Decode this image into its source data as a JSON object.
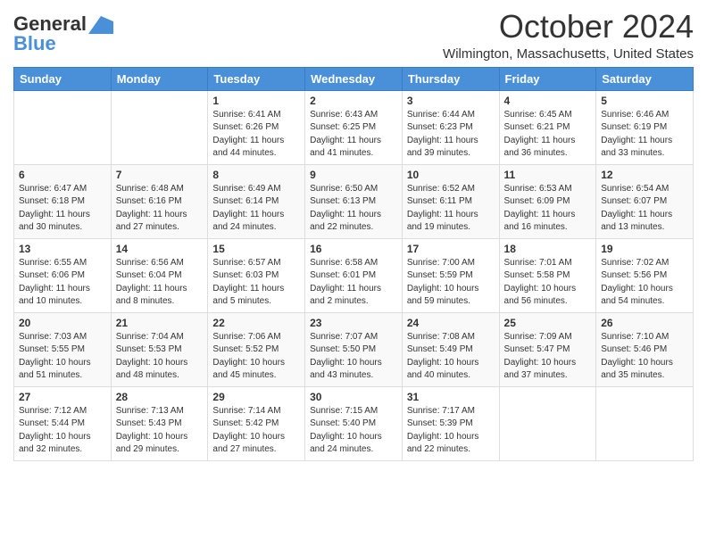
{
  "header": {
    "logo_general": "General",
    "logo_blue": "Blue",
    "month_title": "October 2024",
    "location": "Wilmington, Massachusetts, United States"
  },
  "weekdays": [
    "Sunday",
    "Monday",
    "Tuesday",
    "Wednesday",
    "Thursday",
    "Friday",
    "Saturday"
  ],
  "weeks": [
    [
      {
        "day": "",
        "info": ""
      },
      {
        "day": "",
        "info": ""
      },
      {
        "day": "1",
        "info": "Sunrise: 6:41 AM\nSunset: 6:26 PM\nDaylight: 11 hours and 44 minutes."
      },
      {
        "day": "2",
        "info": "Sunrise: 6:43 AM\nSunset: 6:25 PM\nDaylight: 11 hours and 41 minutes."
      },
      {
        "day": "3",
        "info": "Sunrise: 6:44 AM\nSunset: 6:23 PM\nDaylight: 11 hours and 39 minutes."
      },
      {
        "day": "4",
        "info": "Sunrise: 6:45 AM\nSunset: 6:21 PM\nDaylight: 11 hours and 36 minutes."
      },
      {
        "day": "5",
        "info": "Sunrise: 6:46 AM\nSunset: 6:19 PM\nDaylight: 11 hours and 33 minutes."
      }
    ],
    [
      {
        "day": "6",
        "info": "Sunrise: 6:47 AM\nSunset: 6:18 PM\nDaylight: 11 hours and 30 minutes."
      },
      {
        "day": "7",
        "info": "Sunrise: 6:48 AM\nSunset: 6:16 PM\nDaylight: 11 hours and 27 minutes."
      },
      {
        "day": "8",
        "info": "Sunrise: 6:49 AM\nSunset: 6:14 PM\nDaylight: 11 hours and 24 minutes."
      },
      {
        "day": "9",
        "info": "Sunrise: 6:50 AM\nSunset: 6:13 PM\nDaylight: 11 hours and 22 minutes."
      },
      {
        "day": "10",
        "info": "Sunrise: 6:52 AM\nSunset: 6:11 PM\nDaylight: 11 hours and 19 minutes."
      },
      {
        "day": "11",
        "info": "Sunrise: 6:53 AM\nSunset: 6:09 PM\nDaylight: 11 hours and 16 minutes."
      },
      {
        "day": "12",
        "info": "Sunrise: 6:54 AM\nSunset: 6:07 PM\nDaylight: 11 hours and 13 minutes."
      }
    ],
    [
      {
        "day": "13",
        "info": "Sunrise: 6:55 AM\nSunset: 6:06 PM\nDaylight: 11 hours and 10 minutes."
      },
      {
        "day": "14",
        "info": "Sunrise: 6:56 AM\nSunset: 6:04 PM\nDaylight: 11 hours and 8 minutes."
      },
      {
        "day": "15",
        "info": "Sunrise: 6:57 AM\nSunset: 6:03 PM\nDaylight: 11 hours and 5 minutes."
      },
      {
        "day": "16",
        "info": "Sunrise: 6:58 AM\nSunset: 6:01 PM\nDaylight: 11 hours and 2 minutes."
      },
      {
        "day": "17",
        "info": "Sunrise: 7:00 AM\nSunset: 5:59 PM\nDaylight: 10 hours and 59 minutes."
      },
      {
        "day": "18",
        "info": "Sunrise: 7:01 AM\nSunset: 5:58 PM\nDaylight: 10 hours and 56 minutes."
      },
      {
        "day": "19",
        "info": "Sunrise: 7:02 AM\nSunset: 5:56 PM\nDaylight: 10 hours and 54 minutes."
      }
    ],
    [
      {
        "day": "20",
        "info": "Sunrise: 7:03 AM\nSunset: 5:55 PM\nDaylight: 10 hours and 51 minutes."
      },
      {
        "day": "21",
        "info": "Sunrise: 7:04 AM\nSunset: 5:53 PM\nDaylight: 10 hours and 48 minutes."
      },
      {
        "day": "22",
        "info": "Sunrise: 7:06 AM\nSunset: 5:52 PM\nDaylight: 10 hours and 45 minutes."
      },
      {
        "day": "23",
        "info": "Sunrise: 7:07 AM\nSunset: 5:50 PM\nDaylight: 10 hours and 43 minutes."
      },
      {
        "day": "24",
        "info": "Sunrise: 7:08 AM\nSunset: 5:49 PM\nDaylight: 10 hours and 40 minutes."
      },
      {
        "day": "25",
        "info": "Sunrise: 7:09 AM\nSunset: 5:47 PM\nDaylight: 10 hours and 37 minutes."
      },
      {
        "day": "26",
        "info": "Sunrise: 7:10 AM\nSunset: 5:46 PM\nDaylight: 10 hours and 35 minutes."
      }
    ],
    [
      {
        "day": "27",
        "info": "Sunrise: 7:12 AM\nSunset: 5:44 PM\nDaylight: 10 hours and 32 minutes."
      },
      {
        "day": "28",
        "info": "Sunrise: 7:13 AM\nSunset: 5:43 PM\nDaylight: 10 hours and 29 minutes."
      },
      {
        "day": "29",
        "info": "Sunrise: 7:14 AM\nSunset: 5:42 PM\nDaylight: 10 hours and 27 minutes."
      },
      {
        "day": "30",
        "info": "Sunrise: 7:15 AM\nSunset: 5:40 PM\nDaylight: 10 hours and 24 minutes."
      },
      {
        "day": "31",
        "info": "Sunrise: 7:17 AM\nSunset: 5:39 PM\nDaylight: 10 hours and 22 minutes."
      },
      {
        "day": "",
        "info": ""
      },
      {
        "day": "",
        "info": ""
      }
    ]
  ]
}
